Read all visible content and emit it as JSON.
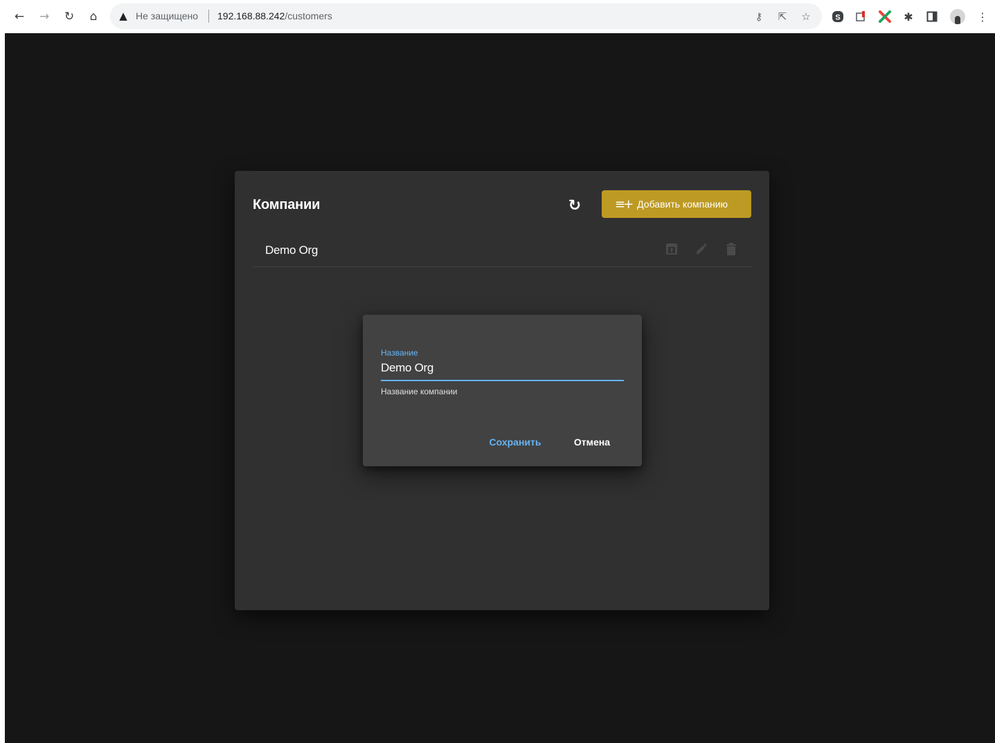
{
  "browser": {
    "security_label": "Не защищено",
    "url_host": "192.168.88.242",
    "url_path": "/customers",
    "nav_icons": [
      "arrow-back-icon",
      "arrow-forward-icon",
      "reload-icon",
      "home-icon"
    ],
    "omnibox_icons": [
      "key-icon",
      "share-icon",
      "star-icon"
    ],
    "extension_icons": [
      "skype-icon",
      "extension-icon",
      "xmind-icon",
      "puzzle-icon",
      "side-panel-icon",
      "profile-avatar",
      "menu-icon"
    ]
  },
  "card": {
    "title": "Компании",
    "add_button_label": "Добавить компанию",
    "add_button_color": "#bd9a24",
    "rows": [
      {
        "name": "Demo Org",
        "actions": [
          "open-icon",
          "edit-icon",
          "delete-icon"
        ]
      }
    ]
  },
  "dialog": {
    "field_label": "Название",
    "field_value": "Demo Org",
    "field_hint": "Название компании",
    "save_label": "Сохранить",
    "cancel_label": "Отмена",
    "accent_color": "#64b5f6"
  }
}
